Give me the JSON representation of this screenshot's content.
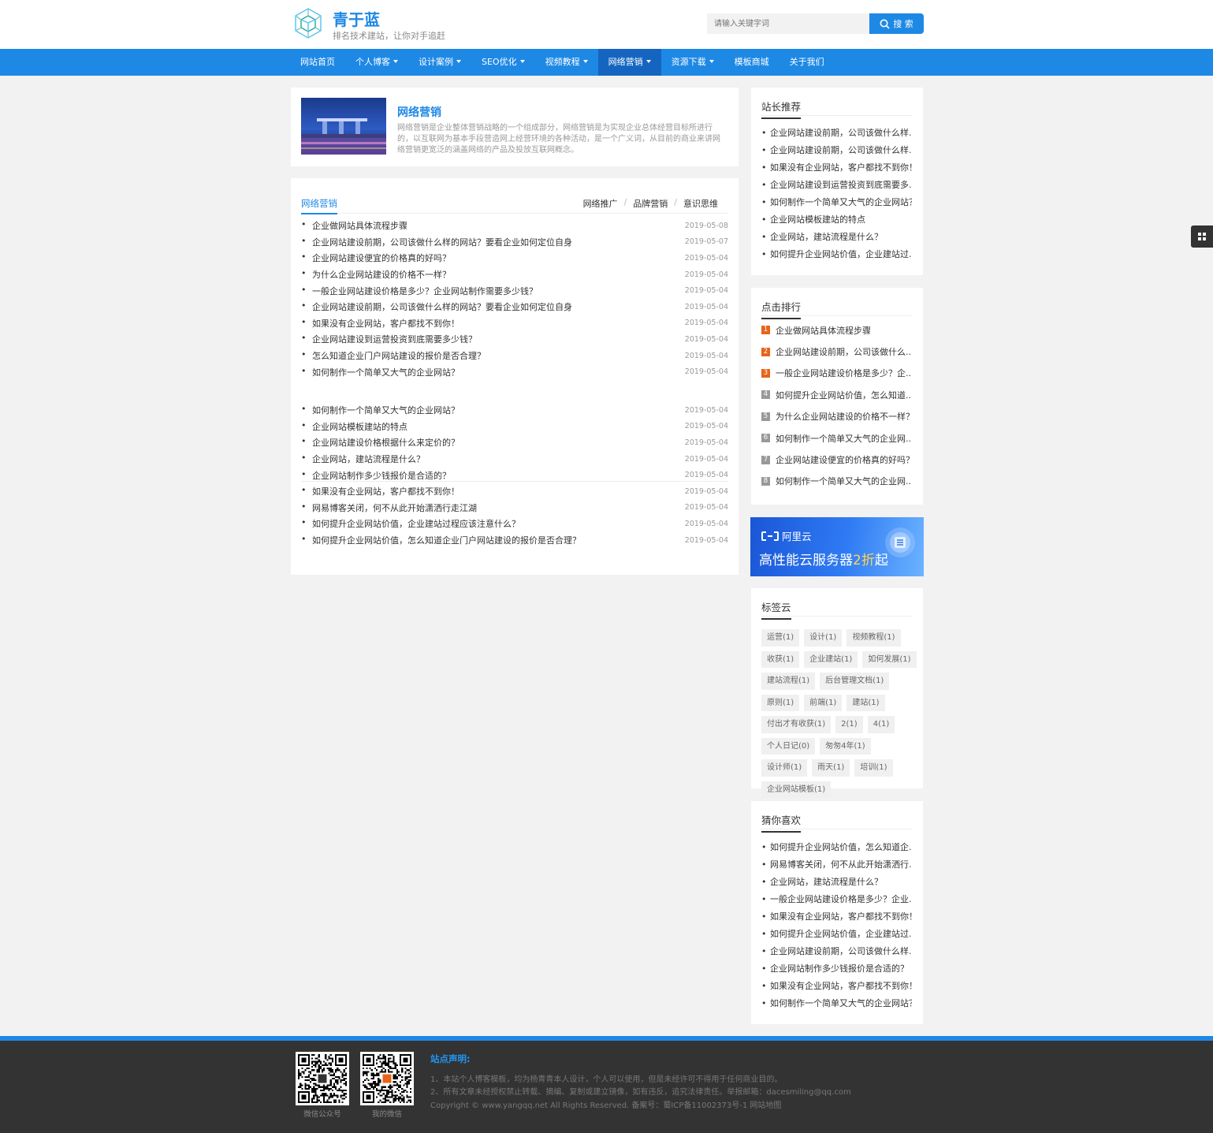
{
  "site": {
    "title": "青于蓝",
    "subtitle": "排名技术建站，让你对手追赶"
  },
  "search": {
    "placeholder": "请输入关键字词",
    "button_label": "搜 索"
  },
  "nav": {
    "items": [
      {
        "label": "网站首页",
        "dropdown": false
      },
      {
        "label": "个人博客",
        "dropdown": true
      },
      {
        "label": "设计案例",
        "dropdown": true
      },
      {
        "label": "SEO优化",
        "dropdown": true
      },
      {
        "label": "视频教程",
        "dropdown": true
      },
      {
        "label": "网络营销",
        "dropdown": true,
        "active": true
      },
      {
        "label": "资源下载",
        "dropdown": true
      },
      {
        "label": "模板商城",
        "dropdown": false
      },
      {
        "label": "关于我们",
        "dropdown": false
      }
    ]
  },
  "category": {
    "title": "网络营销",
    "description": "网络营销是企业整体营销战略的一个组成部分，网络营销是为实现企业总体经营目标所进行的，以互联网为基本手段营造网上经营环境的各种活动，是一个广义词，从目前的商业来讲网络营销更宽泛的涵盖网络的产品及投放互联网概念。"
  },
  "list_tabs": {
    "main": "网络营销",
    "subs": [
      "网络推广",
      "品牌营销",
      "意识思维"
    ]
  },
  "articles_top": [
    {
      "title": "企业做网站具体流程步骤",
      "date": "2019-05-08"
    },
    {
      "title": "企业网站建设前期，公司该做什么样的网站？要看企业如何定位自身",
      "date": "2019-05-07"
    },
    {
      "title": "企业网站建设便宜的价格真的好吗？",
      "date": "2019-05-04"
    },
    {
      "title": "为什么企业网站建设的价格不一样？",
      "date": "2019-05-04"
    },
    {
      "title": "一般企业网站建设价格是多少？企业网站制作需要多少钱？",
      "date": "2019-05-04"
    },
    {
      "title": "企业网站建设前期，公司该做什么样的网站？要看企业如何定位自身",
      "date": "2019-05-04"
    },
    {
      "title": "如果没有企业网站，客户都找不到你！",
      "date": "2019-05-04"
    },
    {
      "title": "企业网站建设到运营投资到底需要多少钱？",
      "date": "2019-05-04"
    },
    {
      "title": "怎么知道企业门户网站建设的报价是否合理？",
      "date": "2019-05-04"
    },
    {
      "title": "如何制作一个简单又大气的企业网站？",
      "date": "2019-05-04"
    }
  ],
  "articles_bottom": [
    {
      "title": "如何制作一个简单又大气的企业网站？",
      "date": "2019-05-04"
    },
    {
      "title": "企业网站模板建站的特点",
      "date": "2019-05-04"
    },
    {
      "title": "企业网站建设价格根据什么来定价的？",
      "date": "2019-05-04"
    },
    {
      "title": "企业网站，建站流程是什么？",
      "date": "2019-05-04"
    },
    {
      "title": "企业网站制作多少钱报价是合适的？",
      "date": "2019-05-04"
    },
    {
      "title": "如果没有企业网站，客户都找不到你！",
      "date": "2019-05-04"
    },
    {
      "title": "网易博客关闭，何不从此开始潇洒行走江湖",
      "date": "2019-05-04"
    },
    {
      "title": "如何提升企业网站价值，企业建站过程应该注意什么？",
      "date": "2019-05-04"
    },
    {
      "title": "如何提升企业网站价值，怎么知道企业门户网站建设的报价是否合理？",
      "date": "2019-05-04"
    }
  ],
  "sidebar": {
    "recommend": {
      "title": "站长推荐",
      "items": [
        "企业网站建设前期，公司该做什么样...",
        "企业网站建设前期，公司该做什么样...",
        "如果没有企业网站，客户都找不到你！",
        "企业网站建设到运营投资到底需要多...",
        "如何制作一个简单又大气的企业网站？",
        "企业网站模板建站的特点",
        "企业网站，建站流程是什么？",
        "如何提升企业网站价值，企业建站过..."
      ]
    },
    "ranking": {
      "title": "点击排行",
      "items": [
        {
          "num": "1",
          "title": "企业做网站具体流程步骤"
        },
        {
          "num": "2",
          "title": "企业网站建设前期，公司该做什么..."
        },
        {
          "num": "3",
          "title": "一般企业网站建设价格是多少？企..."
        },
        {
          "num": "4",
          "title": "如何提升企业网站价值，怎么知道..."
        },
        {
          "num": "5",
          "title": "为什么企业网站建设的价格不一样？"
        },
        {
          "num": "6",
          "title": "如何制作一个简单又大气的企业网..."
        },
        {
          "num": "7",
          "title": "企业网站建设便宜的价格真的好吗？"
        },
        {
          "num": "8",
          "title": "如何制作一个简单又大气的企业网..."
        }
      ],
      "top_color": "#e8641b",
      "other_color": "#999999"
    },
    "ad": {
      "brand": "阿里云",
      "text_before": "高性能云服务器",
      "highlight": "2折",
      "text_after": "起"
    },
    "tags": {
      "title": "标签云",
      "items": [
        "运营(1)",
        "设计(1)",
        "视频教程(1)",
        "收获(1)",
        "企业建站(1)",
        "如何发展(1)",
        "建站流程(1)",
        "后台管理文档(1)",
        "原则(1)",
        "前端(1)",
        "建站(1)",
        "付出才有收获(1)",
        "2(1)",
        "4(1)",
        "个人日记(0)",
        "匆匆4年(1)",
        "设计师(1)",
        "雨天(1)",
        "培训(1)",
        "企业网站模板(1)"
      ]
    },
    "guess": {
      "title": "猜你喜欢",
      "items": [
        "如何提升企业网站价值，怎么知道企...",
        "网易博客关闭，何不从此开始潇洒行...",
        "企业网站，建站流程是什么？",
        "一般企业网站建设价格是多少？企业...",
        "如果没有企业网站，客户都找不到你！",
        "如何提升企业网站价值，企业建站过...",
        "企业网站建设前期，公司该做什么样...",
        "企业网站制作多少钱报价是合适的？",
        "如果没有企业网站，客户都找不到你！",
        "如何制作一个简单又大气的企业网站？"
      ]
    }
  },
  "footer": {
    "qr1_caption": "微信公众号",
    "qr2_caption": "我的微信",
    "title": "站点声明:",
    "lines": [
      "1、本站个人博客模板，均为杨青青本人设计，个人可以使用，但是未经许可不得用于任何商业目的。",
      "2、所有文章未经授权禁止转载、摘编、复制或建立镜像，如有违反，追究法律责任。举报邮箱：dacesmiling@qq.com",
      "Copyright © www.yangqq.net All Rights Reserved. 备案号：蜀ICP备11002373号-1 网站地图"
    ]
  },
  "colors": {
    "primary": "#1e88e5",
    "nav_active": "#1565c0",
    "footer_bg": "#333333"
  },
  "icons": {
    "logo": "cube-logo-icon",
    "search": "search-icon",
    "float": "grid-icon",
    "ad": "aliyun-logo-icon"
  }
}
